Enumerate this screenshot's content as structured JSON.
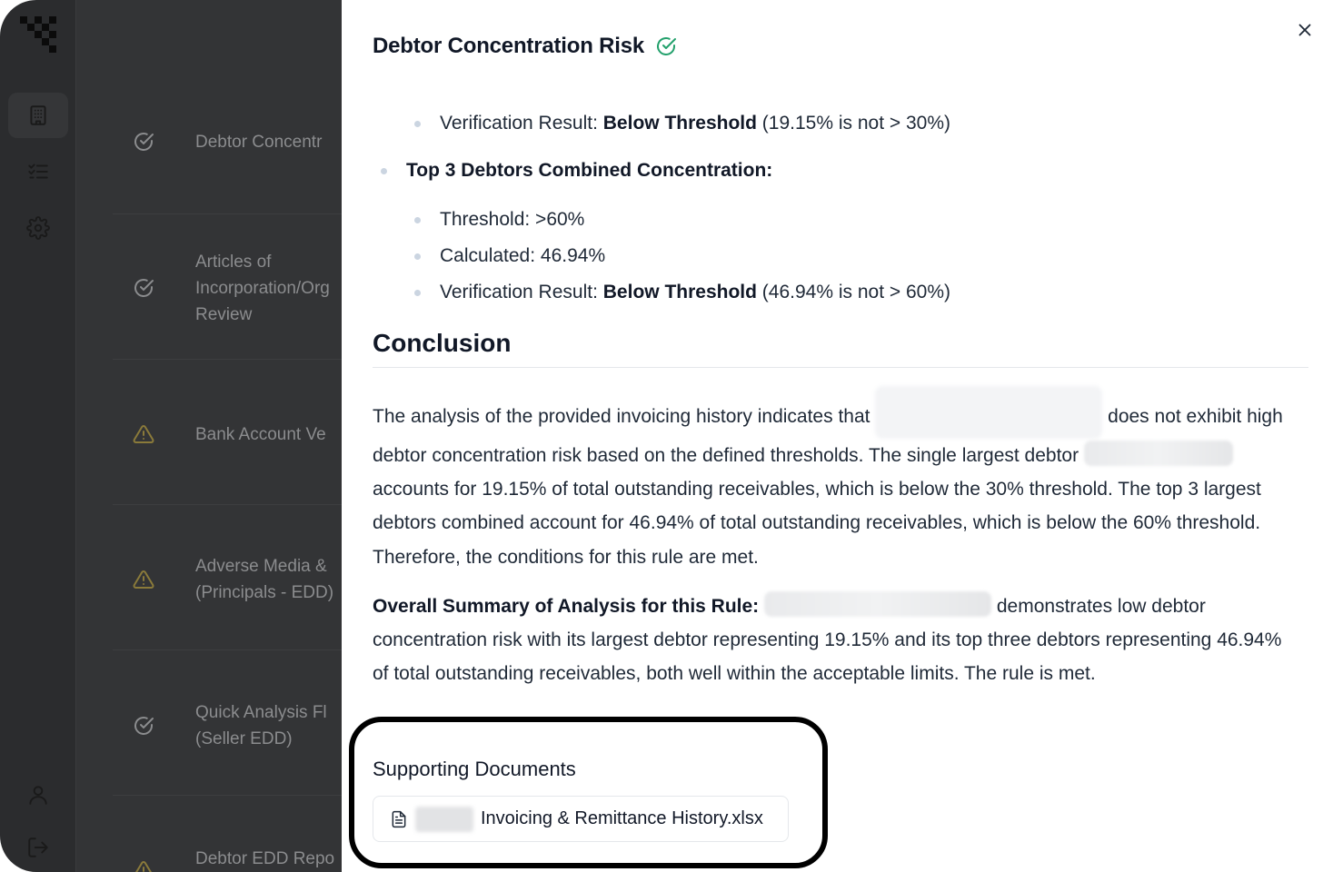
{
  "sidebar": {
    "logo_icon": "checkered-logo",
    "items": [
      {
        "name": "building-icon",
        "active": true
      },
      {
        "name": "checklist-icon",
        "active": false
      },
      {
        "name": "gear-icon",
        "active": false
      }
    ],
    "bottom": [
      {
        "name": "user-icon"
      },
      {
        "name": "logout-icon"
      }
    ]
  },
  "background_list": [
    {
      "status": "check",
      "title": "Debtor Concentr"
    },
    {
      "status": "check",
      "title_lines": [
        "Articles of",
        "Incorporation/Org",
        "Review"
      ]
    },
    {
      "status": "warning",
      "title": "Bank Account Ve"
    },
    {
      "status": "warning",
      "title_lines": [
        "Adverse Media &",
        "(Principals - EDD)"
      ]
    },
    {
      "status": "check",
      "title_lines": [
        "Quick Analysis Fl",
        "(Seller EDD)"
      ]
    },
    {
      "status": "check",
      "title": "Debtor EDD Repo"
    }
  ],
  "panel": {
    "title": "Debtor Concentration Risk",
    "status_icon": "circle-check-icon",
    "status_color": "#22a06b",
    "bullets_before": [
      {
        "label": "Verification Result: ",
        "bold": "Below Threshold",
        "rest": " (19.15% is not > 30%)"
      }
    ],
    "section_head": "Top 3 Debtors Combined Concentration:",
    "section_items": [
      {
        "label": "Threshold: >60%",
        "bold": "",
        "rest": ""
      },
      {
        "label": "Calculated: 46.94%",
        "bold": "",
        "rest": ""
      },
      {
        "label": "Verification Result: ",
        "bold": "Below Threshold",
        "rest": " (46.94% is not > 60%)"
      }
    ],
    "conclusion_heading": "Conclusion",
    "conclusion": {
      "part1": "The analysis of the provided invoicing history indicates that",
      "part2": " does not exhibit high debtor concentration risk based on the defined thresholds. The single largest debtor",
      "part3": " accounts for 19.15% of total outstanding receivables, which is below the 30% threshold. The top 3 largest debtors combined account for 46.94% of total outstanding receivables, which is below the 60% threshold. Therefore, the conditions for this rule are met."
    },
    "summary": {
      "label": "Overall Summary of Analysis for this Rule:",
      "text": " demonstrates low debtor concentration risk with its largest debtor representing 19.15% and its top three debtors representing 46.94% of total outstanding receivables, both well within the acceptable limits. The rule is met."
    },
    "supporting_heading": "Supporting Documents",
    "document": {
      "icon": "file-text-icon",
      "name": "Invoicing & Remittance History.xlsx"
    },
    "close_icon": "close-icon",
    "highlight_color": "#000000"
  }
}
